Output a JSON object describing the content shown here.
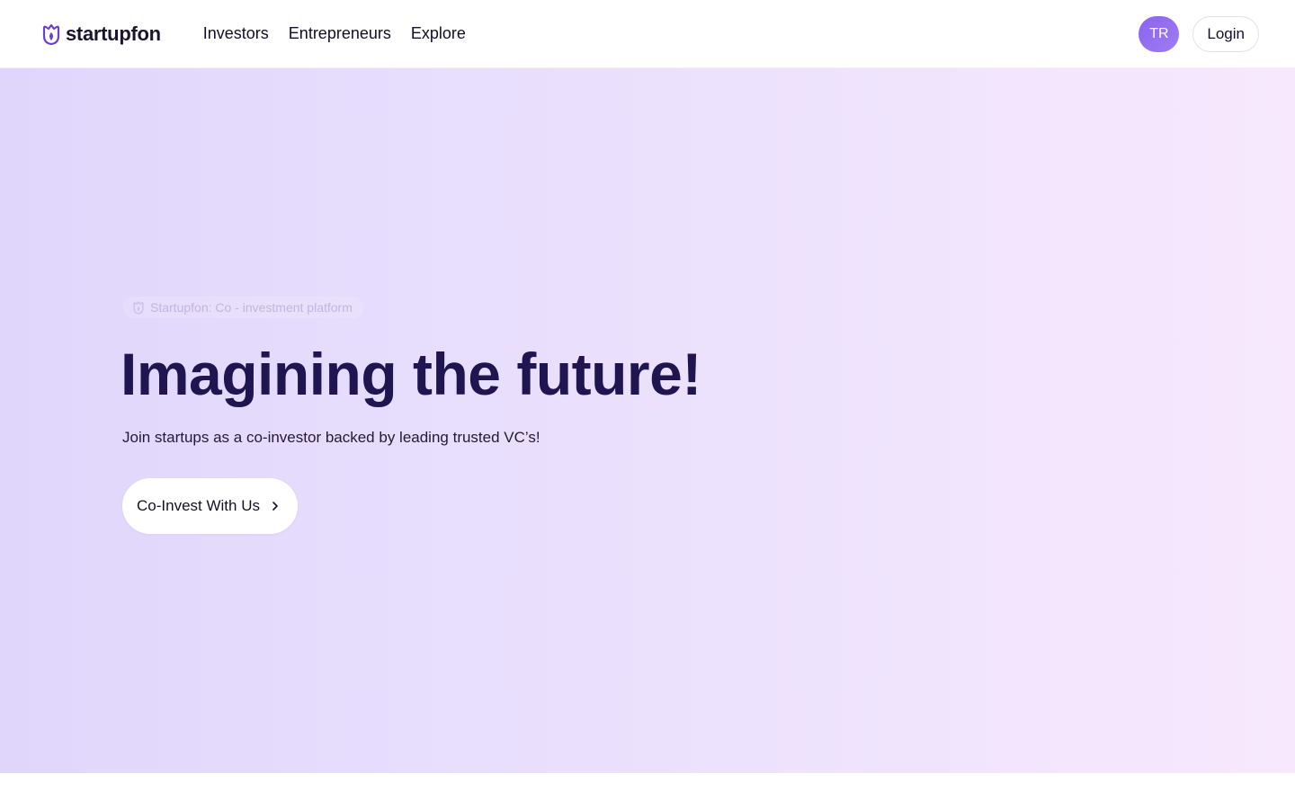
{
  "header": {
    "logo_text": "startupfon",
    "nav": [
      {
        "label": "Investors"
      },
      {
        "label": "Entrepreneurs"
      },
      {
        "label": "Explore"
      }
    ],
    "avatar_initials": "TR",
    "login_label": "Login"
  },
  "hero": {
    "tagline": "Startupfon: Co - investment platform",
    "title": "Imagining the future!",
    "subtitle": "Join startups as a co-investor backed by leading trusted VC’s!",
    "cta_label": "Co-Invest With Us"
  },
  "colors": {
    "brand": "#6a3fd6",
    "title": "#1f1551",
    "avatar": "#8a63ee"
  },
  "icons": {
    "logo": "startupfon-shield-logo-icon",
    "cta": "chevron-right-icon"
  }
}
